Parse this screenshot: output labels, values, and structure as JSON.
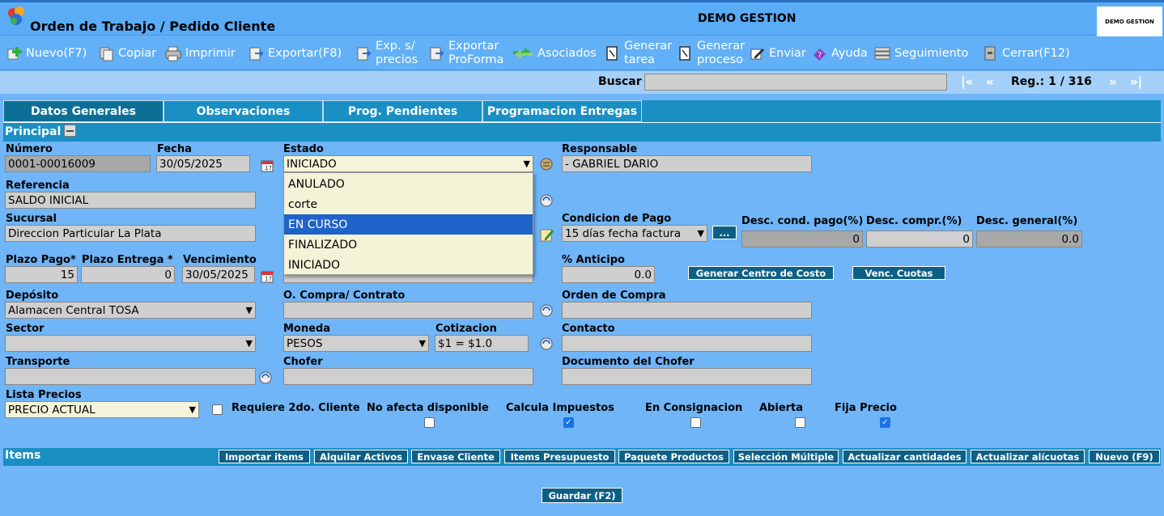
{
  "window": {
    "title": "Orden de Trabajo / Pedido Cliente",
    "company": "DEMO GESTION",
    "logo_text": "DEMO GESTION"
  },
  "toolbar": [
    {
      "label": "Nuevo(F7)",
      "icon": "add-icon"
    },
    {
      "label": "Copiar",
      "icon": "copy-icon"
    },
    {
      "label": "Imprimir",
      "icon": "printer-icon"
    },
    {
      "label": "Exportar(F8)",
      "icon": "export-icon"
    },
    {
      "label": "Exp. s/ precios",
      "line1": "Exp. s/",
      "line2": "precios",
      "icon": "export-icon"
    },
    {
      "label": "Exportar ProForma",
      "line1": "Exportar",
      "line2": "ProForma",
      "icon": "export-icon"
    },
    {
      "label": "Asociados",
      "icon": "arrows-icon"
    },
    {
      "label": "Generar tarea",
      "line1": "Generar",
      "line2": "tarea",
      "icon": "document-icon"
    },
    {
      "label": "Generar proceso",
      "line1": "Generar",
      "line2": "proceso",
      "icon": "document-icon"
    },
    {
      "label": "Enviar",
      "icon": "pencil-icon"
    },
    {
      "label": "Ayuda",
      "icon": "help-icon"
    },
    {
      "label": "Seguimiento",
      "icon": "stack-icon"
    },
    {
      "label": "Cerrar(F12)",
      "icon": "close-icon"
    }
  ],
  "search": {
    "label": "Buscar",
    "value": "",
    "first": "|«",
    "prev": "«",
    "record": "Reg.: 1 / 316",
    "next": "»",
    "last": "»|"
  },
  "tabs": [
    "Datos Generales",
    "Observaciones",
    "Prog. Pendientes",
    "Programacion Entregas"
  ],
  "section_principal": "Principal",
  "fields": {
    "numero": {
      "label": "Número",
      "value": "0001-00016009"
    },
    "fecha": {
      "label": "Fecha",
      "value": "30/05/2025"
    },
    "estado": {
      "label": "Estado",
      "value": "INICIADO",
      "options": [
        "ANULADO",
        "corte",
        "EN CURSO",
        "FINALIZADO",
        "INICIADO"
      ],
      "highlighted": "EN CURSO"
    },
    "responsable": {
      "label": "Responsable",
      "value": "- GABRIEL DARIO"
    },
    "referencia": {
      "label": "Referencia",
      "value": "SALDO INICIAL"
    },
    "sucursal": {
      "label": "Sucursal",
      "value": "Direccion Particular La Plata"
    },
    "condicion_pago": {
      "label": "Condicion de Pago",
      "value": "15 días fecha factura",
      "button": "..."
    },
    "desc_cond_pago": {
      "label": "Desc. cond. pago(%)",
      "value": "0"
    },
    "desc_compr": {
      "label": "Desc. compr.(%)",
      "value": "0"
    },
    "desc_general": {
      "label": "Desc. general(%)",
      "value": "0.0"
    },
    "plazo_pago": {
      "label": "Plazo Pago*",
      "value": "15"
    },
    "plazo_entrega": {
      "label": "Plazo Entrega *",
      "value": "0"
    },
    "vencimiento": {
      "label": "Vencimiento",
      "value": "30/05/2025"
    },
    "anticipo": {
      "label": "% Anticipo",
      "value": "0.0"
    },
    "deposito": {
      "label": "Depósito",
      "value": "Alamacen Central TOSA"
    },
    "o_compra_contrato": {
      "label": "O. Compra/ Contrato",
      "value": ""
    },
    "orden_compra": {
      "label": "Orden de Compra",
      "value": ""
    },
    "sector": {
      "label": "Sector",
      "value": ""
    },
    "moneda": {
      "label": "Moneda",
      "value": "PESOS"
    },
    "cotizacion": {
      "label": "Cotizacion",
      "value": "$1 = $1.0"
    },
    "contacto": {
      "label": "Contacto",
      "value": ""
    },
    "transporte": {
      "label": "Transporte",
      "value": ""
    },
    "chofer": {
      "label": "Chofer",
      "value": ""
    },
    "documento_chofer": {
      "label": "Documento del Chofer",
      "value": ""
    },
    "lista_precios": {
      "label": "Lista Precios",
      "value": "PRECIO ACTUAL"
    }
  },
  "buttons": {
    "centro_costo": "Generar Centro de Costo",
    "venc_cuotas": "Venc. Cuotas",
    "guardar": "Guardar (F2)"
  },
  "checks": {
    "requiere_cliente": {
      "label": "Requiere 2do. Cliente",
      "checked": false
    },
    "no_afecta": {
      "label": "No afecta disponible",
      "checked": false
    },
    "calcula_impuestos": {
      "label": "Calcula Impuestos",
      "checked": true
    },
    "consignacion": {
      "label": "En Consignacion",
      "checked": false
    },
    "abierta": {
      "label": "Abierta",
      "checked": false
    },
    "fija_precio": {
      "label": "Fija Precio",
      "checked": true
    }
  },
  "items": {
    "title": "Items",
    "buttons": [
      "Importar items",
      "Alquilar Activos",
      "Envase Cliente",
      "Items Presupuesto",
      "Paquete Productos",
      "Selección Múltiple",
      "Actualizar cantidades",
      "Actualizar alícuotas",
      "Nuevo (F9)"
    ]
  }
}
